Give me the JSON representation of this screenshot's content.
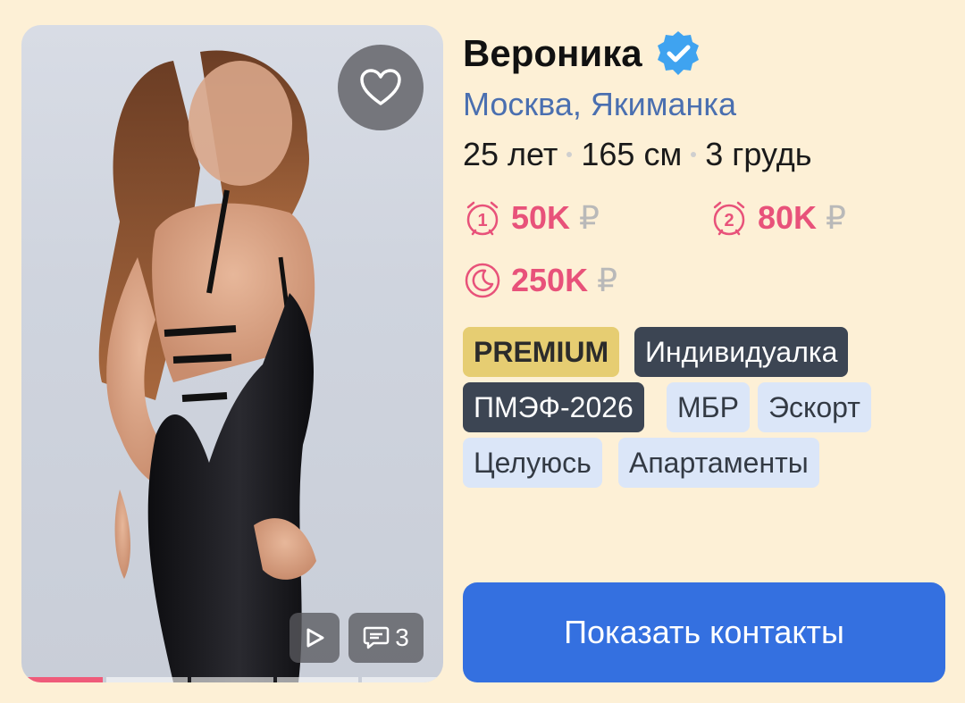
{
  "profile": {
    "name": "Вероника",
    "verified_icon": "verified-badge-icon",
    "location": "Москва, Якиманка",
    "params": [
      "25 лет",
      "165 см",
      "3 грудь"
    ]
  },
  "prices": [
    {
      "icon": "alarm-1-icon",
      "amount": "50K",
      "currency": "₽"
    },
    {
      "icon": "alarm-2-icon",
      "amount": "80K",
      "currency": "₽"
    },
    {
      "icon": "moon-icon",
      "amount": "250K",
      "currency": "₽"
    }
  ],
  "tags": [
    {
      "label": "PREMIUM",
      "style": "premium"
    },
    {
      "label": "Индивидуалка",
      "style": "dark"
    },
    {
      "label": "ПМЭФ-2026",
      "style": "dark"
    },
    {
      "label": "МБР",
      "style": "light"
    },
    {
      "label": "Эскорт",
      "style": "light"
    },
    {
      "label": "Целуюсь",
      "style": "light"
    },
    {
      "label": "Апартаменты",
      "style": "light"
    }
  ],
  "photo": {
    "comments_count": "3",
    "gallery_total": 5,
    "gallery_active": 1
  },
  "actions": {
    "show_contacts": "Показать контакты"
  },
  "colors": {
    "background": "#fdf0d6",
    "accent_blue": "#3470e0",
    "price_pink": "#e8527a",
    "location_blue": "#4a6fb0",
    "premium_gold": "#e6cd72",
    "dark_tag": "#3c4553",
    "light_tag": "#dbe6f8",
    "verified_blue": "#3fa3f0"
  }
}
